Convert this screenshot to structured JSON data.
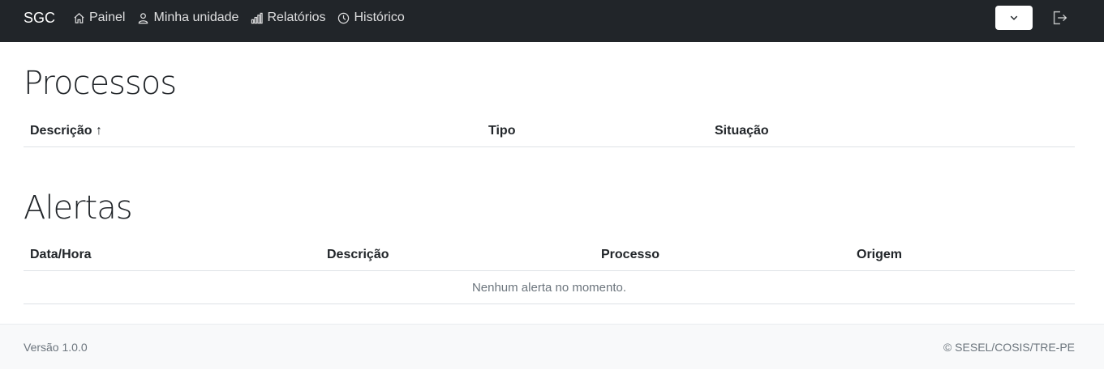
{
  "navbar": {
    "brand": "SGC",
    "links": [
      {
        "label": "Painel",
        "icon": "house-icon"
      },
      {
        "label": "Minha unidade",
        "icon": "person-icon"
      },
      {
        "label": "Relatórios",
        "icon": "bar-chart-icon"
      },
      {
        "label": "Histórico",
        "icon": "clock-icon"
      }
    ],
    "user_dropdown_icon": "chevron-down-icon",
    "logout_icon": "logout-icon"
  },
  "processos": {
    "title": "Processos",
    "columns": [
      "Descrição ↑",
      "Tipo",
      "Situação"
    ]
  },
  "alertas": {
    "title": "Alertas",
    "columns": [
      "Data/Hora",
      "Descrição",
      "Processo",
      "Origem"
    ],
    "empty_message": "Nenhum alerta no momento."
  },
  "footer": {
    "version": "Versão 1.0.0",
    "copyright": "© SESEL/COSIS/TRE-PE"
  }
}
